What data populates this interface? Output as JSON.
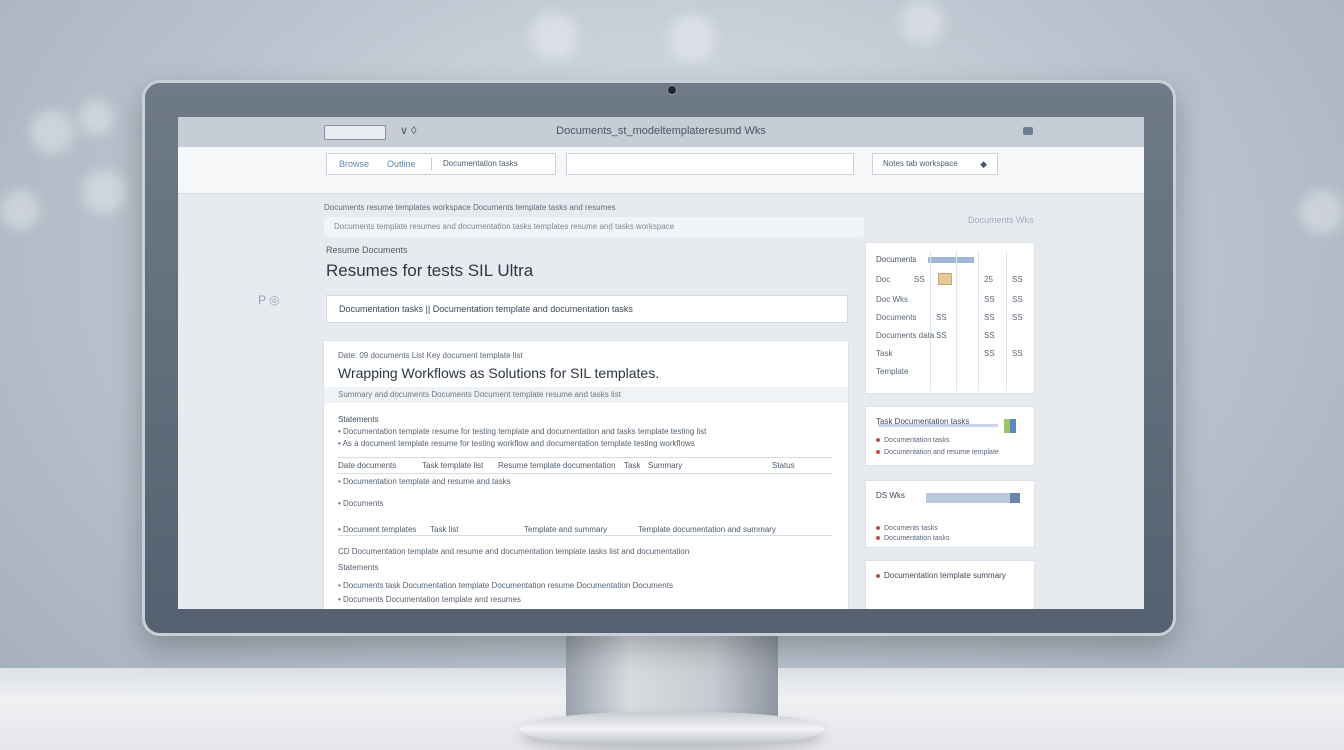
{
  "window": {
    "title": "Documents_st_modeltemplateresumd Wks",
    "controls": "∨ ◊"
  },
  "toolbar": {
    "tab_primary": "Browse",
    "tab_secondary": "Outline",
    "field_text": "Documentation tasks",
    "right_text": "Notes tab workspace",
    "right_icon": "◆"
  },
  "content": {
    "left_marker": "P  ◎",
    "crumb_top": "Documents resume templates workspace     Documents template tasks and resumes",
    "crumb_row": "Documents template resumes and documentation tasks templates resume and tasks workspace",
    "crumb_right": "Documents Wks",
    "section_label": "Resume Documents",
    "page_title": "Resumes for tests SIL Ultra",
    "notice": "Documentation tasks  ||  Documentation template and documentation tasks"
  },
  "card": {
    "meta": "Date: 09 documents  List     Key  document  template list",
    "heading": "Wrapping Workflows as Solutions for SIL templates.",
    "tags": "Summary and documents     Documents   Document template resume and tasks list",
    "sub_heading": "Statements",
    "lines": [
      "•   Documentation template resume for testing template and documentation and tasks template testing list",
      "•   As a document template resume for testing workflow and documentation template testing workflows"
    ],
    "table_row": [
      "Date documents",
      "Task template list",
      "Resume template documentation",
      "Task",
      "Summary",
      "Status"
    ],
    "list_lines": [
      "•   Documentation template and resume and tasks",
      "•   Documents"
    ],
    "divider_labels": [
      "•   Document templates",
      "Task list",
      "Template and summary",
      "Template documentation and summary"
    ],
    "final_lines": [
      "CD   Documentation template and resume and documentation template tasks list and documentation",
      "Statements",
      "•   Documents task  Documentation template  Documentation resume  Documentation  Documents",
      "•   Documents  Documentation template and resumes"
    ]
  },
  "sidebar": {
    "panel1": {
      "header": "Documents",
      "rows": [
        [
          "Doc",
          "SS",
          "25",
          "SS"
        ],
        [
          "Doc Wks",
          "",
          "SS",
          "SS"
        ],
        [
          "Documents",
          "SS",
          "SS",
          "SS"
        ],
        [
          "Documents data",
          "SS",
          "SS",
          ""
        ],
        [
          "Task",
          "",
          "SS",
          "SS"
        ],
        [
          "Template",
          "",
          "",
          ""
        ]
      ]
    },
    "panel2": {
      "title": "Task Documentation tasks",
      "lines": [
        "Documentation tasks",
        "Documentation and resume template"
      ]
    },
    "panel3": {
      "title": "DS Wks",
      "lines": [
        "Documents tasks",
        "Documentation tasks"
      ]
    },
    "panel4": {
      "title": "Documentation template summary"
    }
  }
}
